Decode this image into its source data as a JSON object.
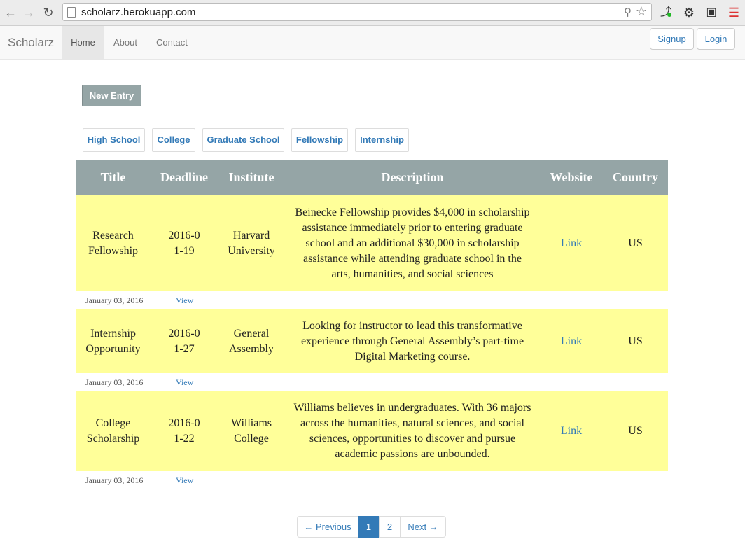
{
  "browser": {
    "url": "scholarz.herokuapp.com",
    "icons": [
      "back-icon",
      "forward-icon",
      "reload-icon",
      "page-icon",
      "zoom-icon",
      "star-icon",
      "extension-icon",
      "gear-icon",
      "cast-icon",
      "menu-icon"
    ]
  },
  "navbar": {
    "brand": "Scholarz",
    "links": [
      "Home",
      "About",
      "Contact"
    ],
    "active": "Home",
    "signup": "Signup",
    "login": "Login"
  },
  "actions": {
    "new_entry": "New Entry"
  },
  "filters": [
    "High School",
    "College",
    "Graduate School",
    "Fellowship",
    "Internship"
  ],
  "table": {
    "headers": [
      "Title",
      "Deadline",
      "Institute",
      "Description",
      "Website",
      "Country"
    ],
    "rows": [
      {
        "title": "Research Fellowship",
        "deadline": "2016-01-19",
        "institute": "Harvard University",
        "description": "Beinecke Fellowship provides $4,000 in scholarship assistance immediately prior to entering graduate school and an additional $30,000 in scholarship assistance while attending graduate school in the arts, humanities, and social sciences",
        "website": "Link",
        "country": "US",
        "posted": "January 03, 2016",
        "view": "View"
      },
      {
        "title": "Internship Opportunity",
        "deadline": "2016-01-27",
        "institute": "General Assembly",
        "description": "Looking for instructor to lead this transformative experience through General Assembly’s part-time Digital Marketing course.",
        "website": "Link",
        "country": "US",
        "posted": "January 03, 2016",
        "view": "View"
      },
      {
        "title": "College Scholarship",
        "deadline": "2016-01-22",
        "institute": "Williams College",
        "description": "Williams believes in undergraduates. With 36 majors across the humanities, natural sciences, and social sciences, opportunities to discover and pursue academic passions are unbounded.",
        "website": "Link",
        "country": "US",
        "posted": "January 03, 2016",
        "view": "View"
      }
    ]
  },
  "pagination": {
    "prev": "← Previous",
    "pages": [
      "1",
      "2"
    ],
    "current": "1",
    "next": "Next →"
  },
  "colors": {
    "accent": "#337ab7",
    "header": "#95a5a6",
    "row_bg": "#ffff99"
  }
}
